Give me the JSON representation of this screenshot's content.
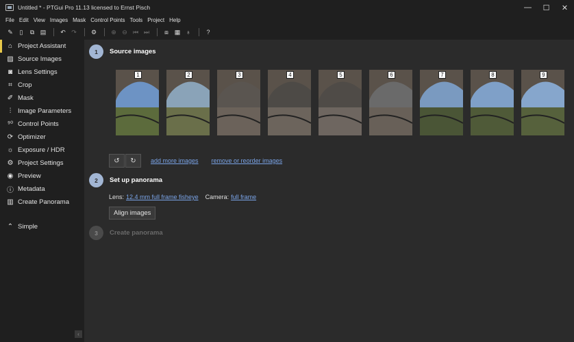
{
  "window": {
    "title": "Untitled * - PTGui Pro 11.13 licensed to Ernst Pisch",
    "controls": [
      "minimize",
      "maximize",
      "close"
    ]
  },
  "menu": [
    "File",
    "Edit",
    "View",
    "Images",
    "Mask",
    "Control Points",
    "Tools",
    "Project",
    "Help"
  ],
  "sidebar": {
    "items": [
      {
        "label": "Project Assistant",
        "icon": "home-icon",
        "active": true
      },
      {
        "label": "Source Images",
        "icon": "image-icon"
      },
      {
        "label": "Lens Settings",
        "icon": "camera-icon"
      },
      {
        "label": "Crop",
        "icon": "crop-icon"
      },
      {
        "label": "Mask",
        "icon": "pen-icon"
      },
      {
        "label": "Image Parameters",
        "icon": "sliders-icon"
      },
      {
        "label": "Control Points",
        "icon": "control-points-icon"
      },
      {
        "label": "Optimizer",
        "icon": "optimizer-icon"
      },
      {
        "label": "Exposure / HDR",
        "icon": "sun-icon"
      },
      {
        "label": "Project Settings",
        "icon": "gear-icon"
      },
      {
        "label": "Preview",
        "icon": "eye-icon"
      },
      {
        "label": "Metadata",
        "icon": "info-icon"
      },
      {
        "label": "Create Panorama",
        "icon": "panorama-icon"
      }
    ],
    "simple_label": "Simple"
  },
  "steps": {
    "step1": {
      "number": "1",
      "title": "Source images"
    },
    "step2": {
      "number": "2",
      "title": "Set up panorama"
    },
    "step3": {
      "number": "3",
      "title": "Create panorama"
    }
  },
  "thumbnails": [
    "1",
    "2",
    "3",
    "4",
    "5",
    "6",
    "7",
    "8",
    "9"
  ],
  "source_actions": {
    "add": "add more images",
    "remove": "remove or reorder images"
  },
  "setup": {
    "lens_label": "Lens:",
    "lens_value": "12.4 mm full frame fisheye",
    "camera_label": "Camera:",
    "camera_value": "full frame",
    "align_button": "Align images"
  },
  "colors": {
    "accent": "#e8c84a",
    "step_circle": "#a2b6d4",
    "link": "#7aa4e8"
  }
}
